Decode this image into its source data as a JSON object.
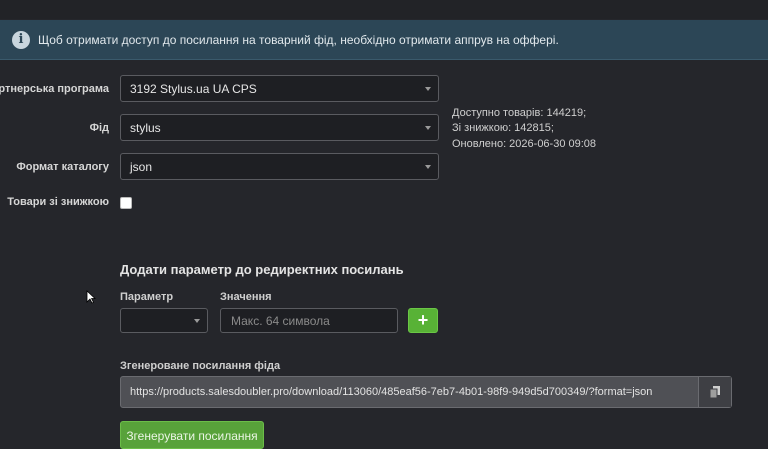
{
  "alert": {
    "icon": "info-icon",
    "text": "Щоб отримати доступ до посилання на товарний фід, необхідно отримати аппрув на оффері."
  },
  "form": {
    "program_label": "Партнерська програма",
    "program_value": "3192 Stylus.ua UA CPS",
    "feed_label": "Фід",
    "feed_value": "stylus",
    "format_label": "Формат каталогу",
    "format_value": "json",
    "discount_label": "Товари зі знижкою",
    "discount_checked": false
  },
  "stats": {
    "available": "Доступно товарів: 144219;",
    "discounted": "Зі знижкою: 142815;",
    "updated": "Оновлено: 2026-06-30 09:08"
  },
  "redirect": {
    "title": "Додати параметр до редиректних посилань",
    "param_label": "Параметр",
    "param_value": "",
    "value_label": "Значення",
    "value_placeholder": "Макс. 64 символа",
    "add_label": "+"
  },
  "generated": {
    "label": "Згенероване посилання фіда",
    "url": "https://products.salesdoubler.pro/download/113060/485eaf56-7eb7-4b01-98f9-949d5d700349/?format=json",
    "copy_icon": "copy-icon",
    "generate_button": "Згенерувати посилання"
  },
  "colors": {
    "background": "#25262b",
    "alert_bg": "#2c4656",
    "accent_green": "#58b236"
  }
}
